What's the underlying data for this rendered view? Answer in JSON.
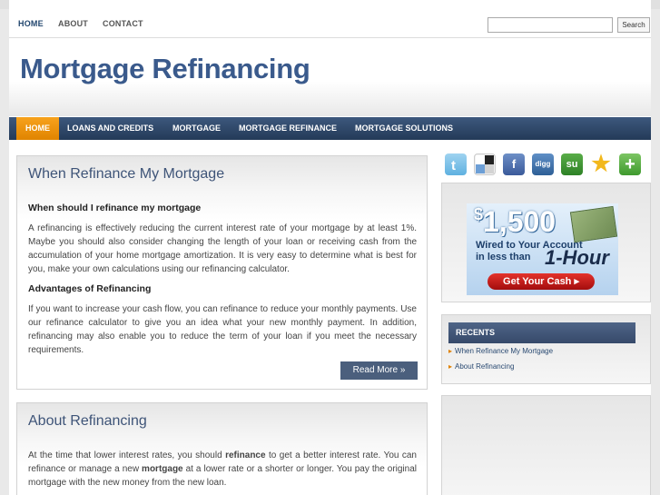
{
  "topnav": {
    "items": [
      "HOME",
      "ABOUT",
      "CONTACT"
    ]
  },
  "search": {
    "button_label": "Search",
    "placeholder": ""
  },
  "site": {
    "title": "Mortgage Refinancing"
  },
  "mainnav": {
    "items": [
      "HOME",
      "LOANS AND CREDITS",
      "MORTGAGE",
      "MORTGAGE REFINANCE",
      "MORTGAGE SOLUTIONS"
    ]
  },
  "posts": [
    {
      "title": "When Refinance My Mortgage",
      "h1": "When should I refinance my mortgage",
      "p1": "A refinancing is effectively reducing the current interest rate of your mortgage by at least 1%. Maybe you should also consider changing the length of your loan or receiving cash from the accumulation of your home mortgage amortization. It is very easy to determine what is best for you, make your own calculations using our refinancing calculator.",
      "h2": "Advantages of Refinancing",
      "p2": "If you want to increase your cash flow, you can refinance to reduce your monthly payments. Use our refinance calculator to give you an idea what your new monthly payment. In addition, refinancing may also enable you to reduce the term of your loan if you meet the necessary requirements.",
      "read_more": "Read More »"
    },
    {
      "title": "About Refinancing",
      "p_a": "At the time that lower interest rates, you should ",
      "p_b": "refinance",
      "p_c": " to get a better interest rate. You can refinance or manage a new ",
      "p_d": "mortgage",
      "p_e": " at a lower rate or a shorter or longer. You pay the original mortgage with the new money from the new loan."
    }
  ],
  "social_icons": [
    "twitter-icon",
    "delicious-icon",
    "facebook-icon",
    "digg-icon",
    "stumbleupon-icon",
    "favorite-star-icon",
    "add-plus-icon"
  ],
  "social_labels": {
    "facebook": "f",
    "digg": "digg",
    "stumbleupon": "su",
    "star": "★",
    "plus": "+"
  },
  "ad": {
    "amount": "1,500",
    "currency": "$",
    "line1": "Wired to Your Account",
    "line2": "in less than",
    "big": "1-Hour",
    "button": "Get Your Cash ▸"
  },
  "recents": {
    "heading": "RECENTS",
    "items": [
      "When Refinance My Mortgage",
      "About Refinancing"
    ]
  },
  "colors": {
    "brand": "#3a5a8c",
    "nav_bg": "#2f4769",
    "active_tab": "#f29a14",
    "read_more_bg": "#4b5f7d"
  }
}
